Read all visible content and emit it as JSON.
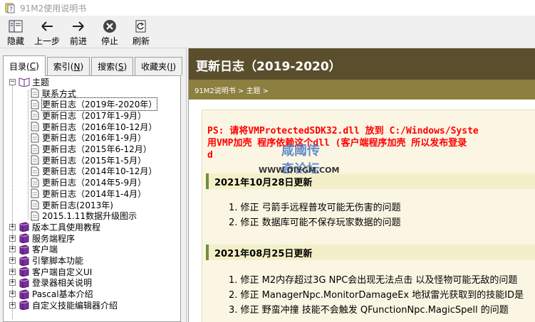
{
  "window": {
    "title": "91M2使用说明书"
  },
  "toolbar": {
    "buttons": [
      {
        "label": "隐藏",
        "icon": "hide-icon"
      },
      {
        "label": "上一步",
        "icon": "back-arrow-icon"
      },
      {
        "label": "前进",
        "icon": "forward-arrow-icon"
      },
      {
        "label": "停止",
        "icon": "stop-icon"
      },
      {
        "label": "刷新",
        "icon": "refresh-icon"
      }
    ]
  },
  "left": {
    "tabs": [
      {
        "text": "目录(",
        "key": "C",
        "tail": ")"
      },
      {
        "text": "索引(",
        "key": "N",
        "tail": ")"
      },
      {
        "text": "搜索(",
        "key": "S",
        "tail": ")"
      },
      {
        "text": "收藏夹(",
        "key": "I",
        "tail": ")"
      }
    ],
    "tree": {
      "root": "主题",
      "children": [
        "联系方式",
        "更新日志（2019年-2020年）",
        "更新日志（2017年1-9月）",
        "更新日志（2016年10-12月）",
        "更新日志（2016年1-9月）",
        "更新日志（2015年6-12月）",
        "更新日志（2015年1-5月）",
        "更新日志（2014年10-12月）",
        "更新日志（2014年5-9月）",
        "更新日志（2014年1-4月）",
        "更新日志(2013年)",
        "2015.1.11数据升级图示"
      ],
      "books": [
        "版本工具使用教程",
        "服务端程序",
        "客户端",
        "引擎脚本功能",
        "客户端自定义UI",
        "登录器相关说明",
        "Pascal基本介绍",
        "自定义技能编辑器介绍"
      ]
    }
  },
  "right": {
    "title": "更新日志（2019-2020）",
    "breadcrumb": "91M2说明书 > 主题 >",
    "ps_line1": "PS: 请将VMProtectedSDK32.dll 放到 C:/Windows/Syste",
    "ps_line2": "用VMP加壳 程序依赖这个dll (客户端程序加壳 所以发布登录",
    "ps_line3": "d",
    "watermark_text": "咸阈传奇论坛",
    "watermark_url": "WWW.DIYGM.COM",
    "sections": [
      {
        "date": "2021年10月28日更新",
        "items": [
          "1. 修正 弓箭手远程普攻可能无伤害的问题",
          "2. 修正 数据库可能不保存玩家数据的问题"
        ]
      },
      {
        "date": "2021年08月25日更新",
        "items": [
          "1. 修正 M2内存超过3G NPC会出现无法点击 以及怪物可能无敌的问题",
          "2. 修正 ManagerNpc.MonitorDamageEx 地狱雷光获取到的技能ID是",
          "3. 修正 野蛮冲撞 技能不会触发 QFunctionNpc.MagicSpell 的问题"
        ]
      }
    ]
  }
}
